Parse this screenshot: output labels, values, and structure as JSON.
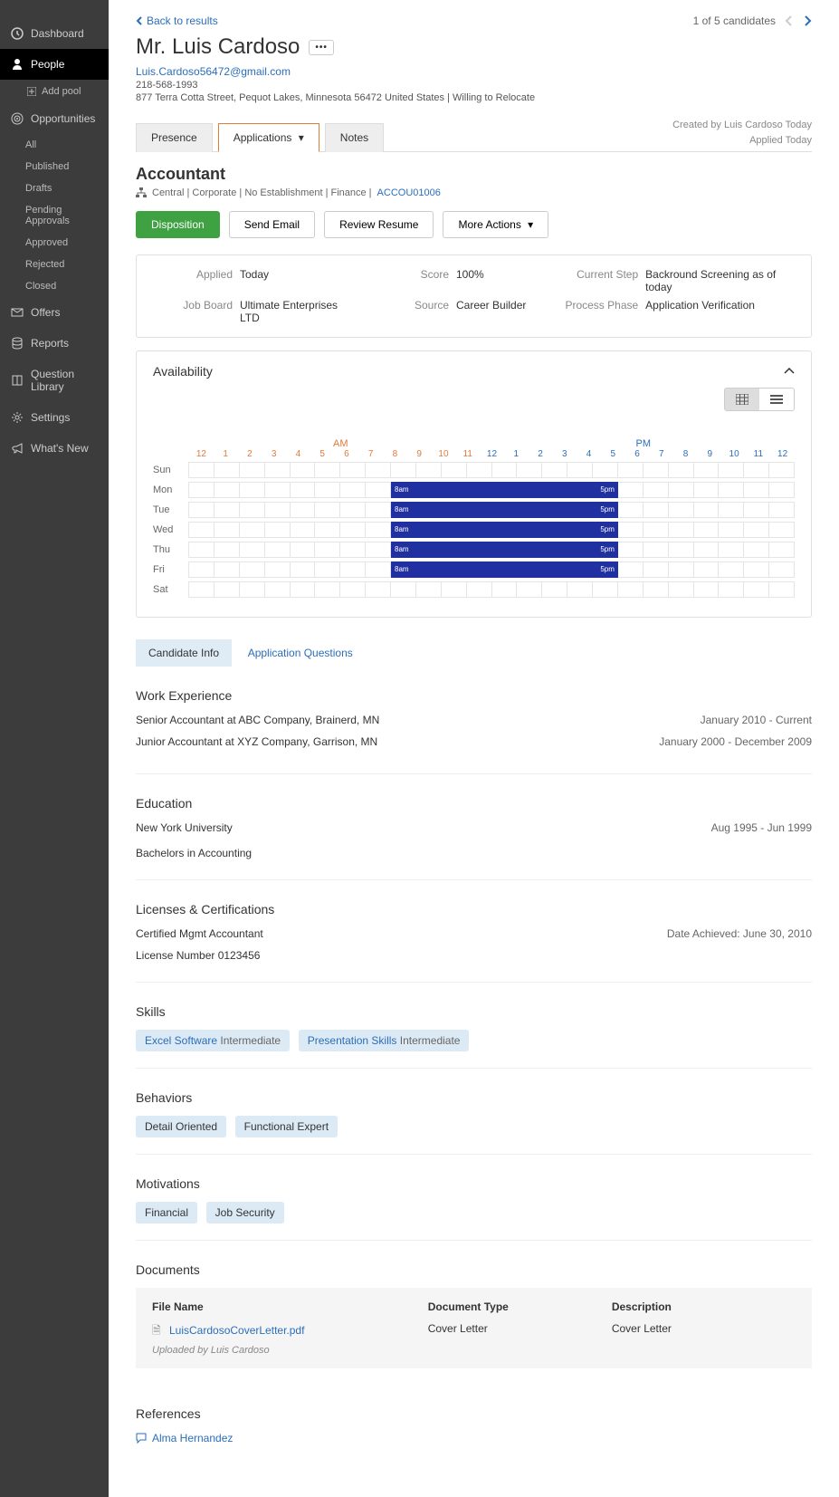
{
  "sidebar": {
    "dashboard": "Dashboard",
    "people": "People",
    "add_pool": "Add pool",
    "opportunities": "Opportunities",
    "opps": {
      "all": "All",
      "published": "Published",
      "drafts": "Drafts",
      "pending": "Pending Approvals",
      "approved": "Approved",
      "rejected": "Rejected",
      "closed": "Closed"
    },
    "offers": "Offers",
    "reports": "Reports",
    "qlib": "Question Library",
    "settings": "Settings",
    "whatsnew": "What's New"
  },
  "top": {
    "back": "Back to results",
    "pager": "1 of 5 candidates"
  },
  "candidate": {
    "name": "Mr. Luis Cardoso",
    "email": "Luis.Cardoso56472@gmail.com",
    "phone": "218-568-1993",
    "address": "877 Terra Cotta Street, Pequot Lakes, Minnesota 56472 United States | Willing to Relocate"
  },
  "tabs": {
    "presence": "Presence",
    "applications": "Applications",
    "notes": "Notes"
  },
  "created": {
    "by": "Created by Luis Cardoso Today",
    "applied": "Applied Today"
  },
  "job": {
    "title": "Accountant",
    "path": "Central | Corporate | No Establishment | Finance |",
    "code": "ACCOU01006"
  },
  "actions": {
    "disposition": "Disposition",
    "send_email": "Send Email",
    "review_resume": "Review Resume",
    "more": "More Actions"
  },
  "summary": {
    "applied_lbl": "Applied",
    "applied": "Today",
    "jobboard_lbl": "Job Board",
    "jobboard": "Ultimate Enterprises LTD",
    "score_lbl": "Score",
    "score": "100%",
    "source_lbl": "Source",
    "source": "Career Builder",
    "step_lbl": "Current Step",
    "step": "Backround Screening as of today",
    "phase_lbl": "Process Phase",
    "phase": "Application Verification"
  },
  "availability": {
    "title": "Availability",
    "am": "AM",
    "pm": "PM",
    "hours": [
      "12",
      "1",
      "2",
      "3",
      "4",
      "5",
      "6",
      "7",
      "8",
      "9",
      "10",
      "11",
      "12",
      "1",
      "2",
      "3",
      "4",
      "5",
      "6",
      "7",
      "8",
      "9",
      "10",
      "11",
      "12"
    ],
    "days": [
      "Sun",
      "Mon",
      "Tue",
      "Wed",
      "Thu",
      "Fri",
      "Sat"
    ],
    "start": "8am",
    "end": "5pm"
  },
  "subtabs": {
    "info": "Candidate Info",
    "questions": "Application Questions"
  },
  "work": {
    "title": "Work Experience",
    "items": [
      {
        "role": "Senior Accountant at ABC Company, Brainerd, MN",
        "when": "January 2010 - Current"
      },
      {
        "role": "Junior Accountant at XYZ Company, Garrison, MN",
        "when": "January 2000 - December 2009"
      }
    ]
  },
  "education": {
    "title": "Education",
    "school": "New York University",
    "degree": "Bachelors in Accounting",
    "when": "Aug 1995 - Jun 1999"
  },
  "licenses": {
    "title": "Licenses & Certifications",
    "name": "Certified Mgmt Accountant",
    "num": "License Number 0123456",
    "date": "Date Achieved: June 30, 2010"
  },
  "skills": {
    "title": "Skills",
    "items": [
      {
        "name": "Excel Software",
        "level": "Intermediate"
      },
      {
        "name": "Presentation Skills",
        "level": "Intermediate"
      }
    ]
  },
  "behaviors": {
    "title": "Behaviors",
    "items": [
      "Detail Oriented",
      "Functional Expert"
    ]
  },
  "motivations": {
    "title": "Motivations",
    "items": [
      "Financial",
      "Job Security"
    ]
  },
  "documents": {
    "title": "Documents",
    "headers": {
      "fname": "File Name",
      "type": "Document Type",
      "desc": "Description"
    },
    "row": {
      "fname": "LuisCardosoCoverLetter.pdf",
      "uploaded": "Uploaded by Luis Cardoso",
      "type": "Cover Letter",
      "desc": "Cover Letter"
    }
  },
  "references": {
    "title": "References",
    "name": "Alma Hernandez"
  }
}
